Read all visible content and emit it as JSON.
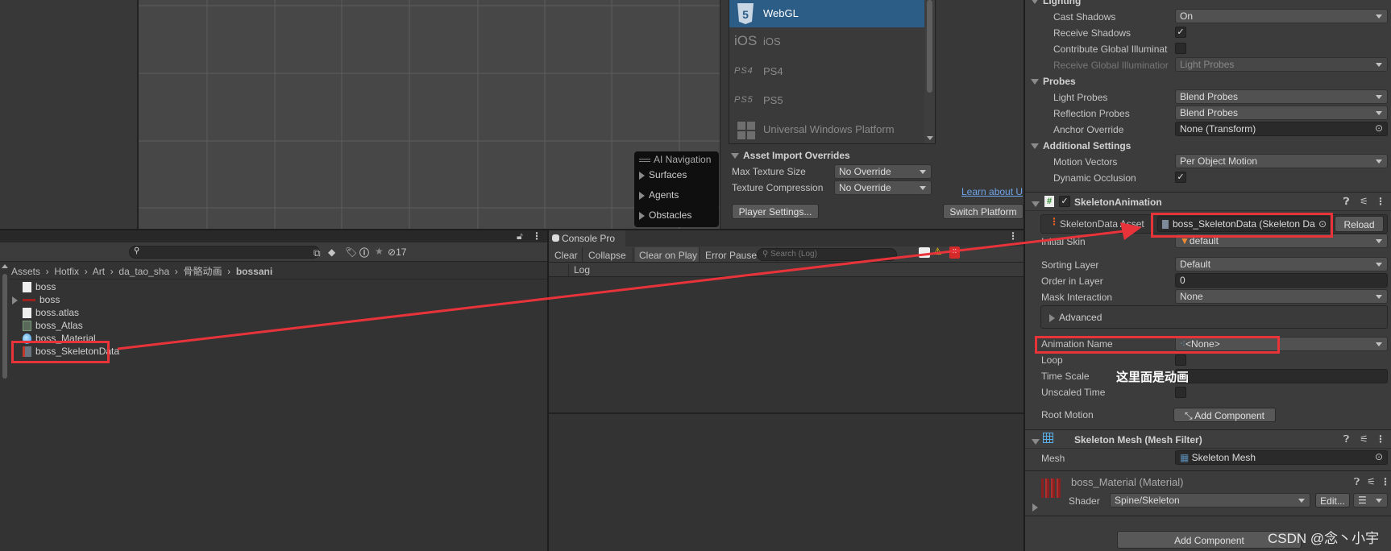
{
  "scene": {
    "overlay": {
      "title": "AI Navigation",
      "items": [
        "Surfaces",
        "Agents",
        "Obstacles"
      ]
    }
  },
  "build": {
    "platforms": [
      {
        "icon": "html5-icon",
        "label": "WebGL",
        "selected": true
      },
      {
        "icon": "ios-icon",
        "icon_text": "iOS",
        "label": "iOS"
      },
      {
        "icon": "ps4-icon",
        "icon_text": "PS4",
        "label": "PS4"
      },
      {
        "icon": "ps5-icon",
        "icon_text": "PS5",
        "label": "PS5"
      },
      {
        "icon": "windows-icon",
        "label": "Universal Windows Platform"
      }
    ],
    "overrides_title": "Asset Import Overrides",
    "max_texture_label": "Max Texture Size",
    "max_texture_value": "No Override",
    "compression_label": "Texture Compression",
    "compression_value": "No Override",
    "learn_link": "Learn about U",
    "player_settings": "Player Settings...",
    "switch_platform": "Switch Platform",
    "selected_color": "#2c5d87"
  },
  "project": {
    "search_placeholder": "",
    "hidden_count": "17",
    "breadcrumb": [
      "Assets",
      "Hotfix",
      "Art",
      "da_tao_sha",
      "骨骼动画",
      "bossani"
    ],
    "items": [
      {
        "icon": "text-file-icon",
        "label": "boss"
      },
      {
        "icon": "skeleton-prefab-icon",
        "label": "boss",
        "expandable": true
      },
      {
        "icon": "text-file-icon",
        "label": "boss.atlas"
      },
      {
        "icon": "atlas-icon",
        "label": "boss_Atlas"
      },
      {
        "icon": "material-icon",
        "label": "boss_Material"
      },
      {
        "icon": "skeleton-data-icon",
        "label": "boss_SkeletonData"
      }
    ]
  },
  "console": {
    "tab": "Console Pro",
    "buttons": [
      "Clear",
      "Collapse",
      "Clear on Play",
      "Error Pause",
      "..."
    ],
    "search_placeholder": "Search (Log)",
    "column": "Log"
  },
  "inspector": {
    "lighting": {
      "title": "Lighting",
      "cast_shadows": {
        "label": "Cast Shadows",
        "value": "On"
      },
      "receive_shadows": {
        "label": "Receive Shadows",
        "checked": true
      },
      "contribute_gi": {
        "label": "Contribute Global Illuminat",
        "checked": false
      },
      "receive_gi": {
        "label": "Receive Global Illuminatior",
        "value": "Light Probes"
      }
    },
    "probes": {
      "title": "Probes",
      "light_probes": {
        "label": "Light Probes",
        "value": "Blend Probes"
      },
      "reflection_probes": {
        "label": "Reflection Probes",
        "value": "Blend Probes"
      },
      "anchor_override": {
        "label": "Anchor Override",
        "value": "None (Transform)"
      }
    },
    "additional": {
      "title": "Additional Settings",
      "motion_vectors": {
        "label": "Motion Vectors",
        "value": "Per Object Motion"
      },
      "dynamic_occlusion": {
        "label": "Dynamic Occlusion",
        "checked": true
      }
    },
    "skeleton_animation": {
      "title": "SkeletonAnimation",
      "enabled": true,
      "skeleton_data": {
        "label": "SkeletonData Asset",
        "value": "boss_SkeletonData (Skeleton Da",
        "reload": "Reload"
      },
      "initial_skin": {
        "label": "Initial Skin",
        "value": "default"
      },
      "sorting_layer": {
        "label": "Sorting Layer",
        "value": "Default"
      },
      "order_in_layer": {
        "label": "Order in Layer",
        "value": "0"
      },
      "mask_interaction": {
        "label": "Mask Interaction",
        "value": "None"
      },
      "advanced": "Advanced",
      "animation_name": {
        "label": "Animation Name",
        "value": "<None>"
      },
      "loop": {
        "label": "Loop",
        "checked": false
      },
      "time_scale": {
        "label": "Time Scale",
        "value": ""
      },
      "unscaled_time": {
        "label": "Unscaled Time",
        "checked": false
      },
      "root_motion": {
        "label": "Root Motion",
        "button": "Add Component"
      }
    },
    "mesh_filter": {
      "title": "Skeleton Mesh (Mesh Filter)",
      "mesh": {
        "label": "Mesh",
        "value": "Skeleton Mesh"
      }
    },
    "material": {
      "title": "boss_Material (Material)",
      "shader_label": "Shader",
      "shader_value": "Spine/Skeleton",
      "edit": "Edit..."
    },
    "add_component": "Add Component"
  },
  "annotation": {
    "note": "这里面是动画",
    "color": "#e8333a"
  },
  "watermark": "CSDN @念丶小宇"
}
